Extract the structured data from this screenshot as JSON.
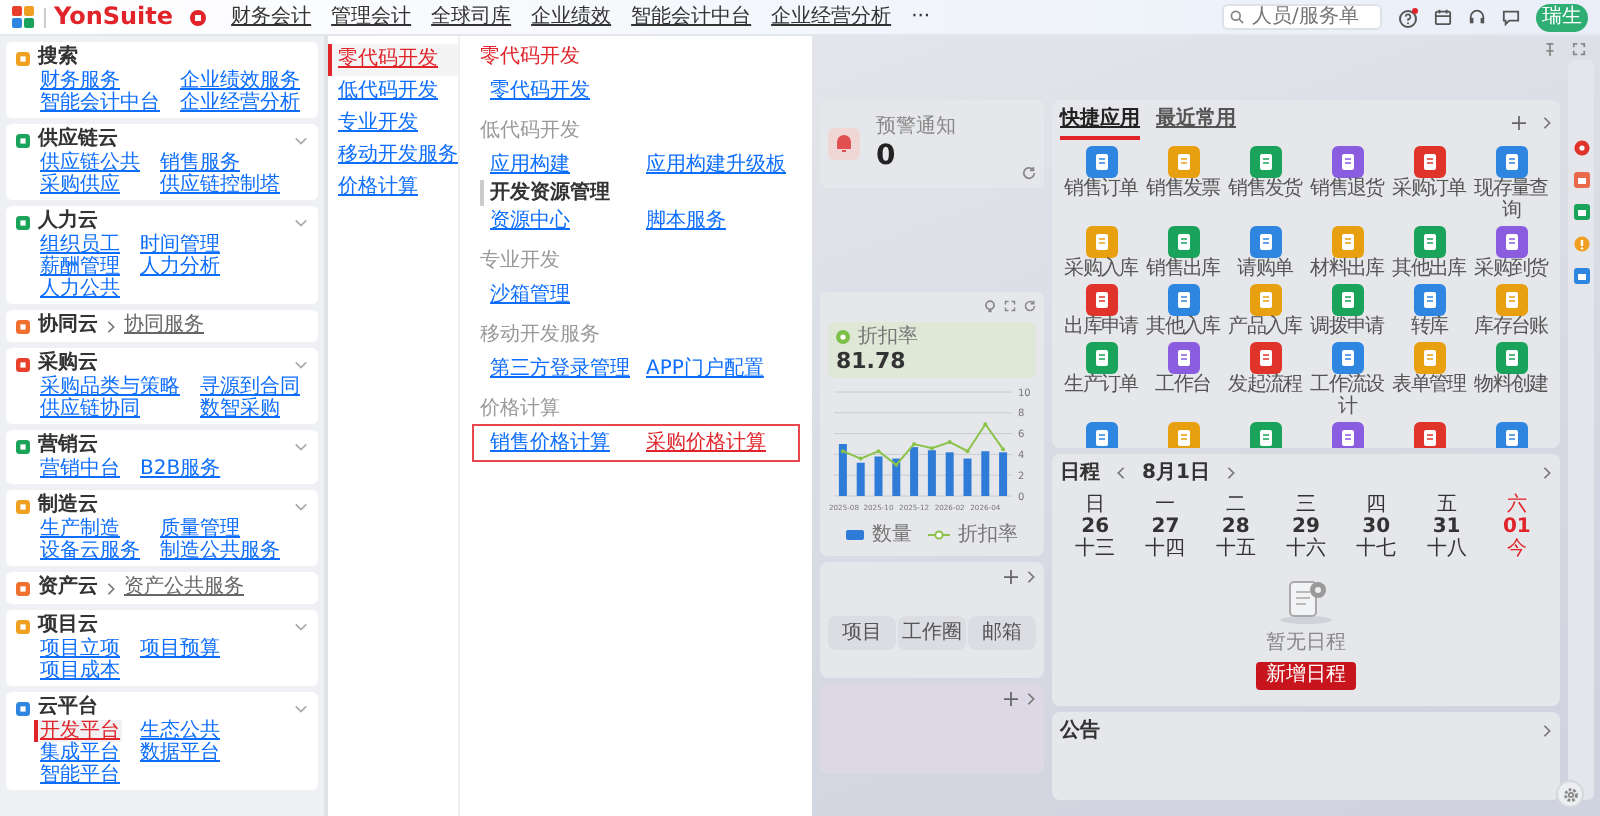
{
  "top_bar": {
    "brand": "YonSuite",
    "menus": [
      "财务会计",
      "管理会计",
      "全球司库",
      "企业绩效",
      "智能会计中台",
      "企业经营分析"
    ],
    "more": "···",
    "search": {
      "placeholder": "人员/服务单"
    },
    "avatar": "瑞生"
  },
  "sidebar": {
    "groups": [
      {
        "kind": "search",
        "title": "搜索",
        "color": "#f0a020",
        "items": [
          {
            "label": "财务服务",
            "selected": false
          },
          {
            "label": "企业绩效服务",
            "selected": false
          },
          {
            "label": "智能会计中台",
            "selected": false
          },
          {
            "label": "企业经营分析",
            "selected": false
          }
        ]
      },
      {
        "kind": "group",
        "title": "供应链云",
        "color": "#1aa35a",
        "items": [
          {
            "label": "供应链公共",
            "selected": false
          },
          {
            "label": "销售服务",
            "selected": false
          },
          {
            "label": "采购供应",
            "selected": false
          },
          {
            "label": "供应链控制塔",
            "selected": false
          }
        ]
      },
      {
        "kind": "group",
        "title": "人力云",
        "color": "#1aa35a",
        "items": [
          {
            "label": "组织员工",
            "selected": false
          },
          {
            "label": "时间管理",
            "selected": false
          },
          {
            "label": "薪酬管理",
            "selected": false
          },
          {
            "label": "人力分析",
            "selected": false
          },
          {
            "label": "人力公共",
            "selected": false
          }
        ]
      },
      {
        "kind": "link",
        "title": "协同云",
        "color": "#f07030",
        "link": "协同服务"
      },
      {
        "kind": "group",
        "title": "采购云",
        "color": "#e8402a",
        "items": [
          {
            "label": "采购品类与策略",
            "selected": false
          },
          {
            "label": "寻源到合同",
            "selected": false
          },
          {
            "label": "供应链协同",
            "selected": false
          },
          {
            "label": "数智采购",
            "selected": false
          }
        ]
      },
      {
        "kind": "group",
        "title": "营销云",
        "color": "#1aa35a",
        "items": [
          {
            "label": "营销中台",
            "selected": false
          },
          {
            "label": "B2B服务",
            "selected": false
          }
        ]
      },
      {
        "kind": "group",
        "title": "制造云",
        "color": "#f0a020",
        "items": [
          {
            "label": "生产制造",
            "selected": false
          },
          {
            "label": "质量管理",
            "selected": false
          },
          {
            "label": "设备云服务",
            "selected": false
          },
          {
            "label": "制造公共服务",
            "selected": false
          }
        ]
      },
      {
        "kind": "link",
        "title": "资产云",
        "color": "#f07030",
        "link": "资产公共服务"
      },
      {
        "kind": "group",
        "title": "项目云",
        "color": "#f0a020",
        "items": [
          {
            "label": "项目立项",
            "selected": false
          },
          {
            "label": "项目预算",
            "selected": false
          },
          {
            "label": "项目成本",
            "selected": false
          }
        ]
      },
      {
        "kind": "group",
        "title": "云平台",
        "color": "#2f86e0",
        "items": [
          {
            "label": "开发平台",
            "selected": true
          },
          {
            "label": "生态公共",
            "selected": false
          },
          {
            "label": "集成平台",
            "selected": false
          },
          {
            "label": "数据平台",
            "selected": false
          },
          {
            "label": "智能平台",
            "selected": false
          }
        ]
      }
    ]
  },
  "submenu": [
    {
      "label": "零代码开发",
      "selected": true
    },
    {
      "label": "低代码开发",
      "selected": false
    },
    {
      "label": "专业开发",
      "selected": false
    },
    {
      "label": "移动开发服务",
      "selected": false
    },
    {
      "label": "价格计算",
      "selected": false
    }
  ],
  "services": [
    {
      "title": "零代码开发",
      "active": true,
      "highlighted": false,
      "rows": [
        {
          "kind": "item",
          "label": "零代码开发",
          "selected": false
        }
      ]
    },
    {
      "title": "低代码开发",
      "active": false,
      "highlighted": false,
      "rows": [
        {
          "kind": "item",
          "label": "应用构建",
          "selected": false
        },
        {
          "kind": "item",
          "label": "应用构建升级板",
          "selected": false
        },
        {
          "kind": "group",
          "label": "开发资源管理"
        },
        {
          "kind": "item",
          "label": "资源中心",
          "selected": false
        },
        {
          "kind": "item",
          "label": "脚本服务",
          "selected": false
        }
      ]
    },
    {
      "title": "专业开发",
      "active": false,
      "highlighted": false,
      "rows": [
        {
          "kind": "item",
          "label": "沙箱管理",
          "selected": false
        }
      ]
    },
    {
      "title": "移动开发服务",
      "active": false,
      "highlighted": false,
      "rows": [
        {
          "kind": "item",
          "label": "第三方登录管理",
          "selected": false
        },
        {
          "kind": "item",
          "label": "APP门户配置",
          "selected": false
        }
      ]
    },
    {
      "title": "价格计算",
      "active": false,
      "highlighted": true,
      "rows": [
        {
          "kind": "item",
          "label": "销售价格计算",
          "selected": false
        },
        {
          "kind": "item",
          "label": "采购价格计算",
          "selected": true
        }
      ]
    }
  ],
  "dashboard": {
    "alert": {
      "label": "预警通知",
      "value": "0"
    },
    "metric": {
      "label": "折扣率",
      "value": "81.78"
    },
    "chart_data": {
      "type": "bar",
      "categories": [
        "2025-08",
        null,
        "2025-10",
        null,
        "2025-12",
        null,
        "2026-02",
        null,
        "2026-04",
        null
      ],
      "yticks": [
        0,
        2,
        4,
        6,
        8,
        10
      ],
      "ylim": [
        0,
        10
      ],
      "grid": true,
      "series": [
        {
          "name": "数量",
          "color": "#2f7bd8",
          "type": "bar",
          "values": [
            5.0,
            3.2,
            3.8,
            3.6,
            4.7,
            4.4,
            4.2,
            3.6,
            4.3,
            4.2
          ]
        },
        {
          "name": "折扣率",
          "color": "#8bc34a",
          "type": "line",
          "values": [
            4.3,
            3.6,
            4.3,
            3.0,
            5.0,
            4.6,
            5.2,
            4.3,
            6.9,
            4.5
          ]
        }
      ]
    },
    "shortcuts": [
      "项目",
      "工作圈",
      "邮箱"
    ],
    "quick_apps": {
      "tabs": [
        {
          "label": "快捷应用",
          "selected": true
        },
        {
          "label": "最近常用",
          "selected": false
        }
      ],
      "apps": [
        {
          "label": "销售订单",
          "color": "#2f86e0"
        },
        {
          "label": "销售发票",
          "color": "#e8a010"
        },
        {
          "label": "销售发货",
          "color": "#1aa35a"
        },
        {
          "label": "销售退货",
          "color": "#8a5ce0"
        },
        {
          "label": "采购订单",
          "color": "#e0342a"
        },
        {
          "label": "现存量查询",
          "color": "#2f86e0"
        },
        {
          "label": "采购入库",
          "color": "#e8a010"
        },
        {
          "label": "销售出库",
          "color": "#1aa35a"
        },
        {
          "label": "请购单",
          "color": "#2f86e0"
        },
        {
          "label": "材料出库",
          "color": "#e8a010"
        },
        {
          "label": "其他出库",
          "color": "#1aa35a"
        },
        {
          "label": "采购到货",
          "color": "#8a5ce0"
        },
        {
          "label": "出库申请",
          "color": "#e0342a"
        },
        {
          "label": "其他入库",
          "color": "#2f86e0"
        },
        {
          "label": "产品入库",
          "color": "#e8a010"
        },
        {
          "label": "调拨申请",
          "color": "#1aa35a"
        },
        {
          "label": "转库",
          "color": "#2f86e0"
        },
        {
          "label": "库存台账",
          "color": "#e8a010"
        },
        {
          "label": "生产订单",
          "color": "#1aa35a"
        },
        {
          "label": "工作台",
          "color": "#8a5ce0"
        },
        {
          "label": "发起流程",
          "color": "#e0342a"
        },
        {
          "label": "工作流设计",
          "color": "#2f86e0"
        },
        {
          "label": "表单管理",
          "color": "#e8a010"
        },
        {
          "label": "物料创建",
          "color": "#1aa35a"
        },
        {
          "color": "#2f86e0"
        },
        {
          "color": "#e8a010"
        },
        {
          "color": "#1aa35a"
        },
        {
          "color": "#8a5ce0"
        },
        {
          "color": "#e0342a"
        },
        {
          "color": "#2f86e0"
        }
      ]
    },
    "calendar": {
      "title": "日程",
      "month_day": "8月1日",
      "days": [
        {
          "weekday": "日",
          "date": "26",
          "lunar": "十三",
          "today": false
        },
        {
          "weekday": "一",
          "date": "27",
          "lunar": "十四",
          "today": false
        },
        {
          "weekday": "二",
          "date": "28",
          "lunar": "十五",
          "today": false
        },
        {
          "weekday": "三",
          "date": "29",
          "lunar": "十六",
          "today": false
        },
        {
          "weekday": "四",
          "date": "30",
          "lunar": "十七",
          "today": false
        },
        {
          "weekday": "五",
          "date": "31",
          "lunar": "十八",
          "today": false
        },
        {
          "weekday": "六",
          "date": "01",
          "lunar": "今",
          "today": true
        }
      ],
      "empty_text": "暂无日程",
      "add_button": "新增日程"
    },
    "notice": {
      "title": "公告"
    }
  }
}
